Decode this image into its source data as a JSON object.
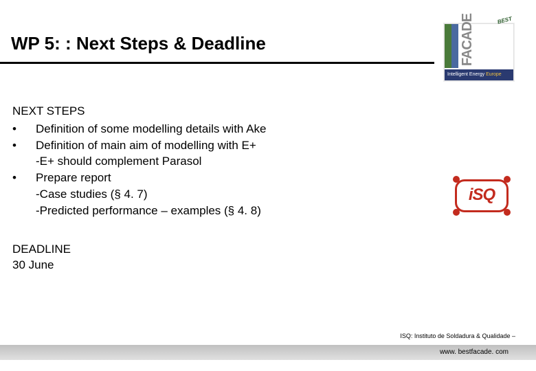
{
  "title": "WP 5: : Next Steps & Deadline",
  "facade_logo": {
    "brand": "FACADE",
    "tag": "BEST",
    "bar_left": "Intelligent Energy",
    "bar_right": "Europe"
  },
  "content": {
    "heading": "NEXT STEPS",
    "items": [
      {
        "bullet": "•",
        "text": "Definition of some modelling details with Ake"
      },
      {
        "bullet": "•",
        "text": "Definition of main aim of modelling with E+"
      },
      {
        "bullet": "",
        "text": "-E+ should complement Parasol"
      },
      {
        "bullet": "•",
        "text": "Prepare report"
      },
      {
        "bullet": "",
        "text": "-Case studies (§ 4. 7)"
      },
      {
        "bullet": "",
        "text": "-Predicted performance – examples (§ 4. 8)"
      }
    ],
    "deadline_heading": "DEADLINE",
    "deadline_date": "30 June"
  },
  "isq_logo": {
    "text": "iSQ"
  },
  "footer_credit": "ISQ: Instituto de Soldadura & Qualidade –",
  "footer_url": "www. bestfacade. com"
}
